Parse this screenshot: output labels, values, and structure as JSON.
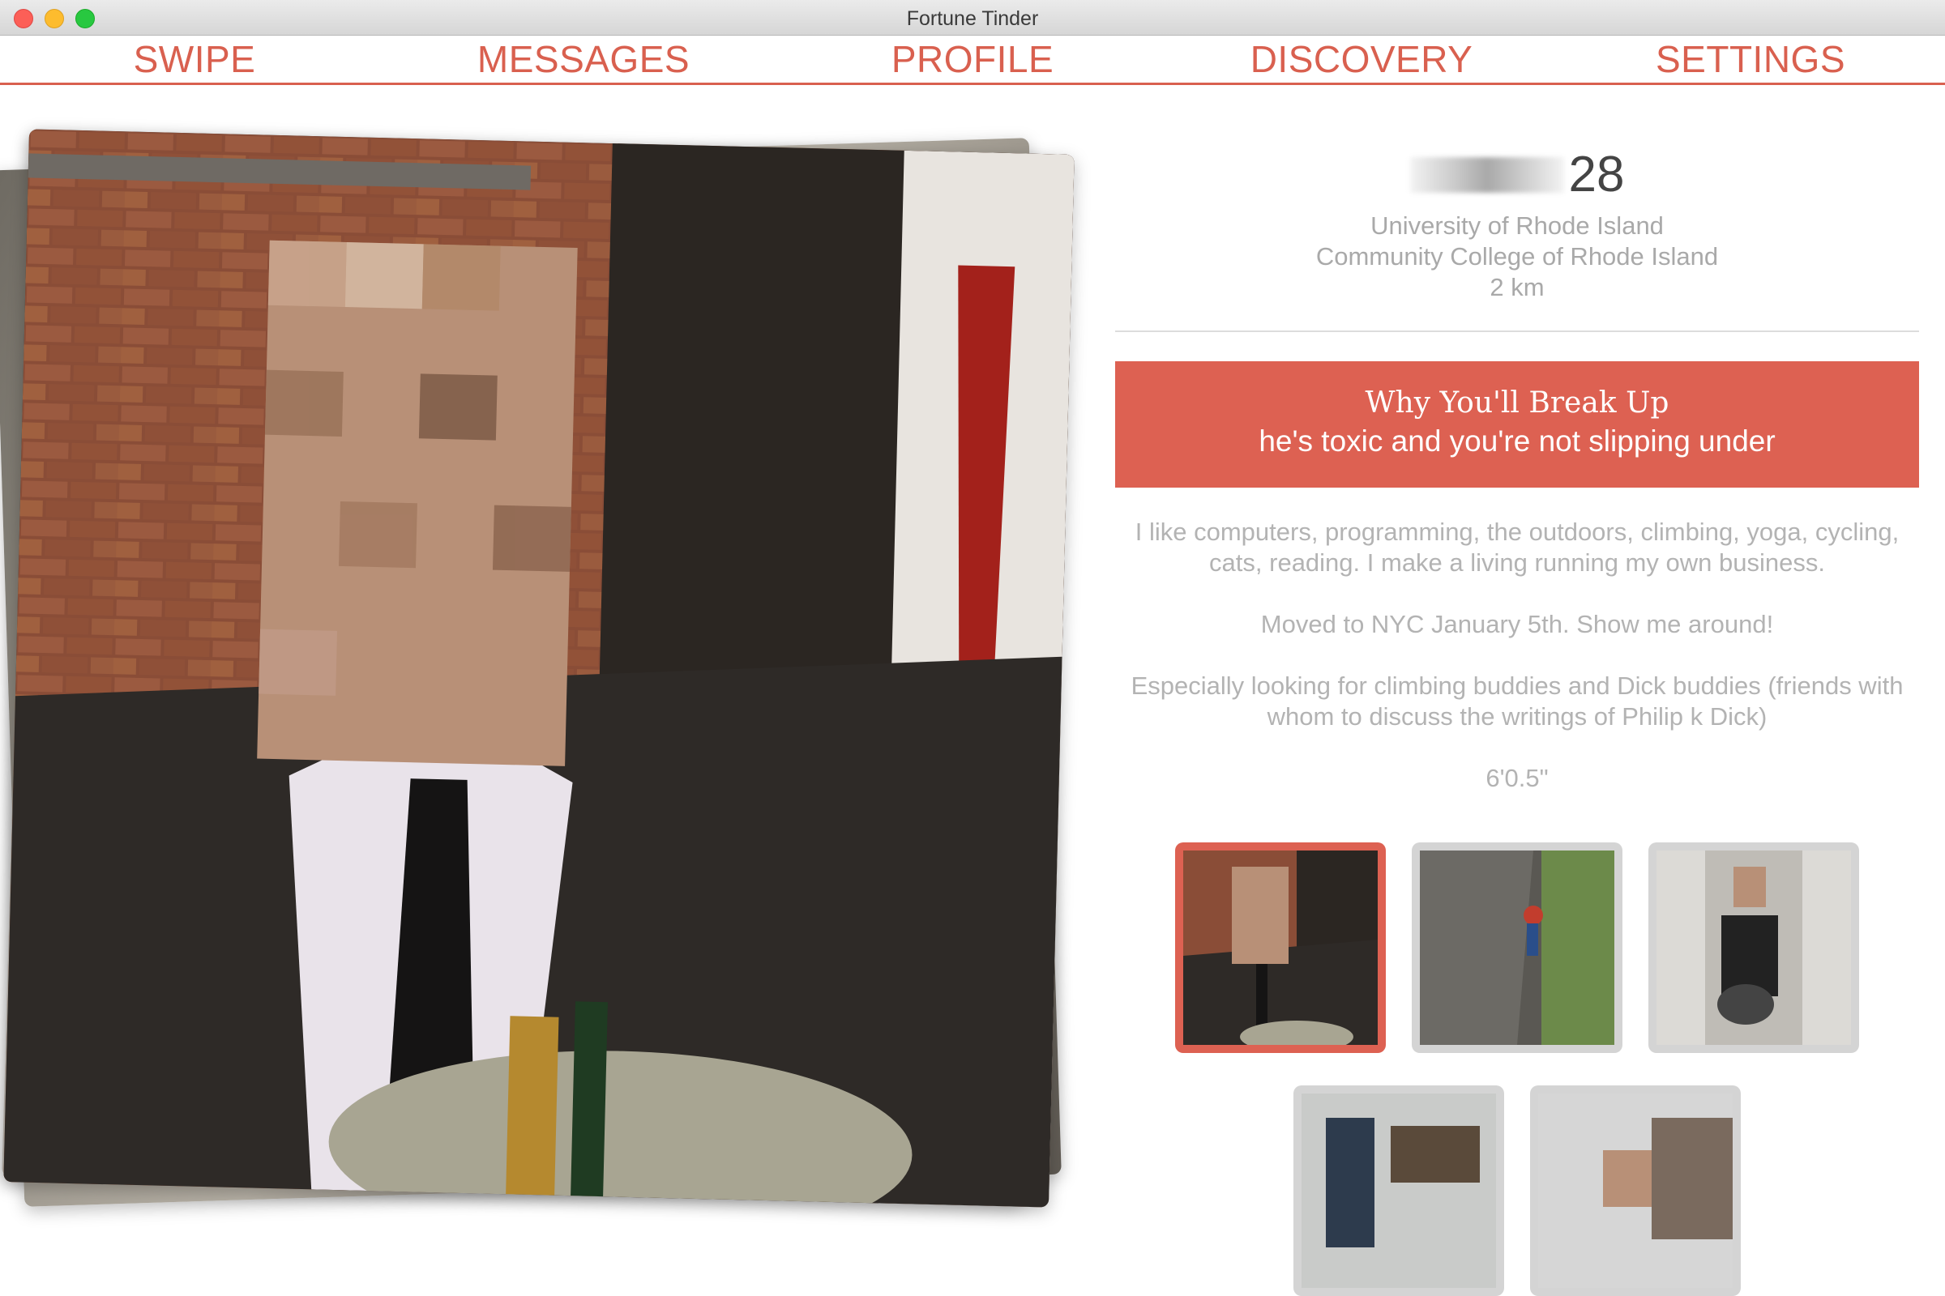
{
  "window": {
    "title": "Fortune Tinder"
  },
  "nav": {
    "items": [
      "SWIPE",
      "MESSAGES",
      "PROFILE",
      "DISCOVERY",
      "SETTINGS"
    ]
  },
  "profile": {
    "age": "28",
    "schools": [
      "University of Rhode Island",
      "Community College of Rhode Island"
    ],
    "distance": "2 km"
  },
  "fortune": {
    "title": "Why You'll Break Up",
    "reason": "he's toxic and you're not slipping under"
  },
  "bio": {
    "paragraphs": [
      "I like computers, programming, the outdoors, climbing, yoga, cycling, cats, reading. I make a living running my own business.",
      "Moved to NYC January 5th. Show me around!",
      "Especially looking for climbing buddies and Dick buddies (friends with whom to discuss the writings of Philip k Dick)",
      "6'0.5\""
    ]
  },
  "colors": {
    "accent": "#dd6152",
    "muted_text": "#a9a9a9"
  },
  "photos": {
    "count": 5,
    "selected_index": 0
  }
}
